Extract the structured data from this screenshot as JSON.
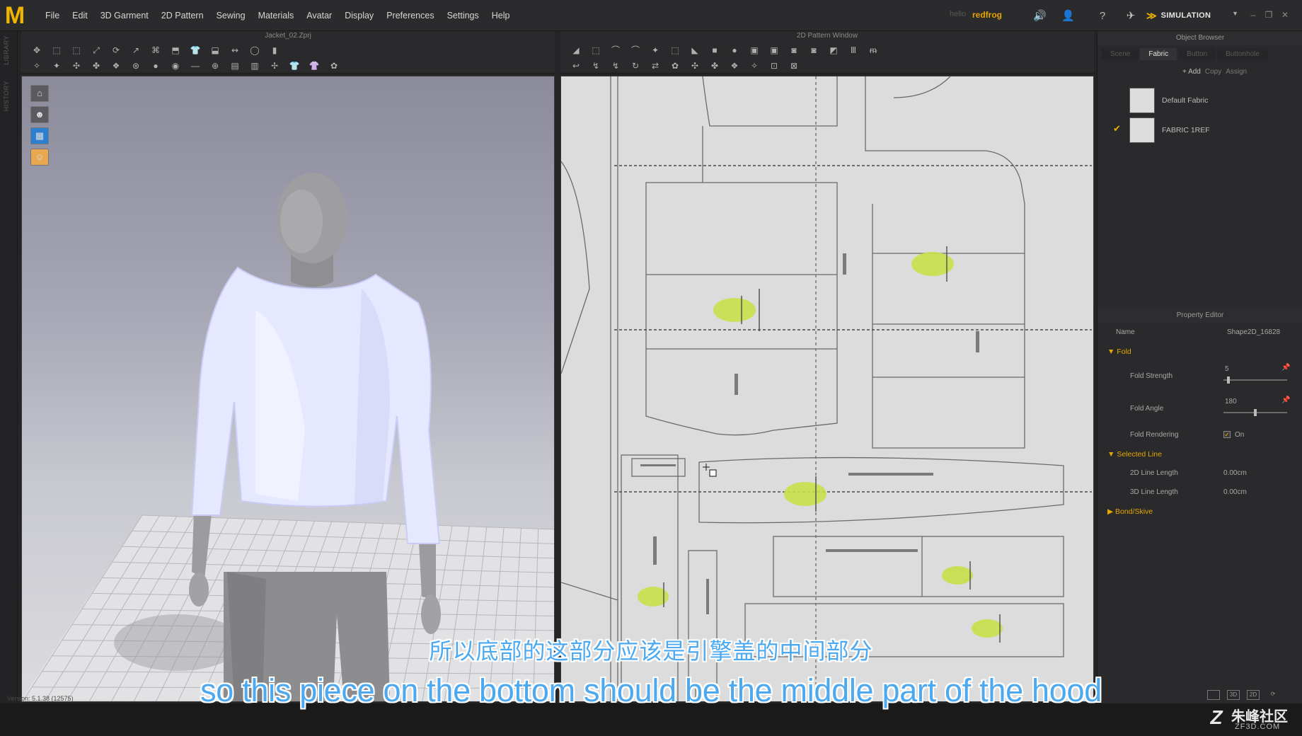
{
  "menubar": {
    "logo": "M",
    "items": [
      "File",
      "Edit",
      "3D Garment",
      "2D Pattern",
      "Sewing",
      "Materials",
      "Avatar",
      "Display",
      "Preferences",
      "Settings",
      "Help"
    ],
    "user_prefix": "hello",
    "user": "redfrog",
    "mode": "SIMULATION"
  },
  "side_tabs": {
    "library": "LIBRARY",
    "history": "HISTORY"
  },
  "view3d": {
    "title": "Jacket_02.Zprj",
    "version": "Version: 5.1.38 (12575)"
  },
  "view2d": {
    "title": "2D Pattern Window"
  },
  "object_browser": {
    "title": "Object Browser",
    "tabs": [
      "Scene",
      "Fabric",
      "Button",
      "Buttonhole"
    ],
    "active_tab": "Fabric",
    "actions": [
      "+ Add",
      "Copy",
      "Assign"
    ],
    "fabrics": [
      "Default Fabric",
      "FABRIC 1REF"
    ]
  },
  "property_editor": {
    "title": "Property Editor",
    "name_label": "Name",
    "name_value": "Shape2D_16828",
    "fold_section": "Fold",
    "fold_strength_label": "Fold Strength",
    "fold_strength_value": "5",
    "fold_strength_level": 0.06,
    "fold_angle_label": "Fold Angle",
    "fold_angle_value": "180",
    "fold_angle_level": 0.5,
    "fold_rendering_label": "Fold Rendering",
    "fold_rendering_value": "On",
    "selected_line_section": "Selected Line",
    "line2d_label": "2D Line Length",
    "line2d_value": "0.00cm",
    "line3d_label": "3D Line Length",
    "line3d_value": "0.00cm",
    "bond_section": "Bond/Skive"
  },
  "subtitles": {
    "chinese": "所以底部的这部分应该是引擎盖的中间部分",
    "english": "so this piece on the bottom should be the middle part of the hood"
  },
  "watermark": {
    "cn": "朱峰社区",
    "en": "ZF3D.COM"
  },
  "colors": {
    "accent": "#f0b400",
    "subtitle": "#4ca9f0",
    "garment": "#e6e8ff",
    "pin": "#c8e04a"
  }
}
